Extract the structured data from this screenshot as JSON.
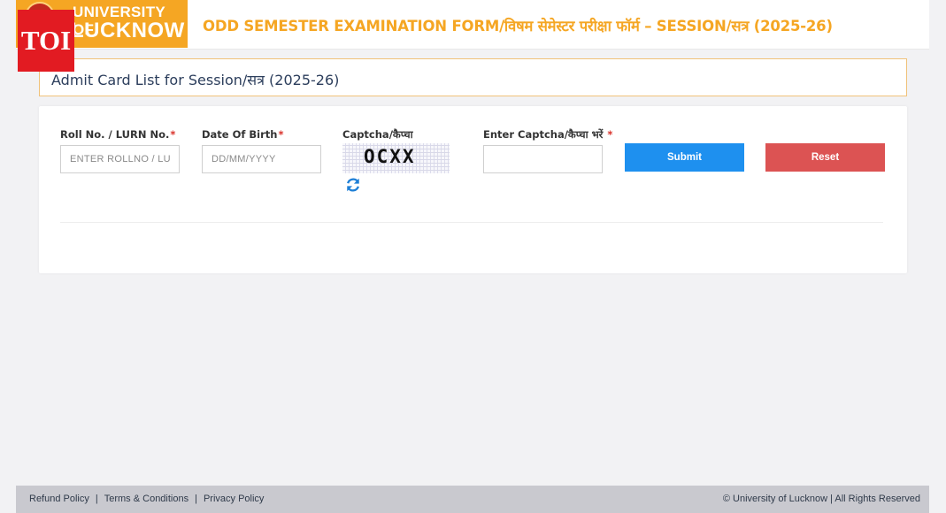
{
  "badge": {
    "text": "TOI"
  },
  "header": {
    "logo_line1": "UNIVERSITY OF",
    "logo_line2": "LUCKNOW",
    "title": "ODD SEMESTER EXAMINATION FORM/विषम सेमेस्टर परीक्षा फॉर्म – SESSION/सत्र (2025-26)"
  },
  "section": {
    "title": "Admit Card List for Session/सत्र (2025-26)"
  },
  "form": {
    "roll_label": "Roll No. / LURN No.",
    "roll_placeholder": "ENTER ROLLNO / LURN",
    "dob_label": "Date Of Birth",
    "dob_placeholder": "DD/MM/YYYY",
    "captcha_label": "Captcha/कैप्चा",
    "captcha_text": "OCXX",
    "enter_captcha_label": "Enter Captcha/कैप्चा भरें",
    "required_mark": "*",
    "submit_label": "Submit",
    "reset_label": "Reset"
  },
  "footer": {
    "links": [
      "Refund Policy",
      "Terms & Conditions",
      "Privacy Policy"
    ],
    "separator": "|",
    "copyright": "© University of Lucknow  | All Rights Reserved"
  },
  "colors": {
    "brand_orange": "#f5a623",
    "submit_blue": "#1e90ef",
    "reset_red": "#dc5353",
    "toi_red": "#e21b22"
  },
  "icons": [
    "university-emblem-icon",
    "refresh-icon"
  ]
}
